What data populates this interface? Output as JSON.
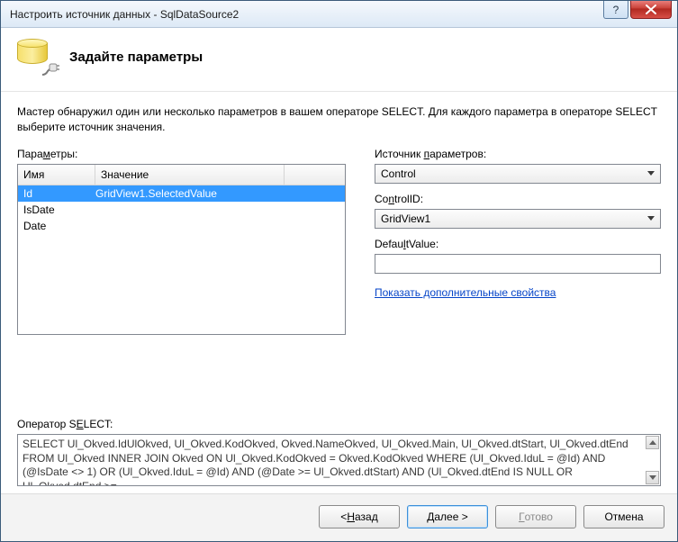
{
  "window_title": "Настроить источник данных - SqlDataSource2",
  "header": {
    "title": "Задайте параметры"
  },
  "instruction": "Мастер обнаружил один или несколько параметров в вашем операторе SELECT. Для каждого параметра в операторе SELECT выберите источник значения.",
  "left": {
    "params_label_pre": "Пара",
    "params_label_u": "м",
    "params_label_post": "етры:",
    "col_name": "Имя",
    "col_value": "Значение",
    "rows": [
      {
        "name": "Id",
        "value": "GridView1.SelectedValue"
      },
      {
        "name": "IsDate",
        "value": ""
      },
      {
        "name": "Date",
        "value": ""
      }
    ]
  },
  "right": {
    "src_label_pre": "Источник ",
    "src_label_u": "п",
    "src_label_post": "араметров:",
    "src_value": "Control",
    "ctrlid_label_pre": "Co",
    "ctrlid_label_u": "n",
    "ctrlid_label_post": "trolID:",
    "ctrlid_value": "GridView1",
    "default_label_pre": "Defau",
    "default_label_u": "l",
    "default_label_post": "tValue:",
    "default_value": "",
    "advanced_link": "Показать дополнительные свойства"
  },
  "sql": {
    "label": "Оператор S",
    "label_u": "E",
    "label_post": "LECT:",
    "text": "SELECT Ul_Okved.IdUlOkved, Ul_Okved.KodOkved, Okved.NameOkved, Ul_Okved.Main, Ul_Okved.dtStart, Ul_Okved.dtEnd FROM Ul_Okved INNER JOIN Okved ON Ul_Okved.KodOkved = Okved.KodOkved WHERE (Ul_Okved.IduL = @Id) AND (@IsDate <> 1) OR (Ul_Okved.IduL = @Id) AND (@Date >= Ul_Okved.dtStart) AND (Ul_Okved.dtEnd IS NULL OR Ul_Okved.dtEnd >="
  },
  "buttons": {
    "back_pre": "< ",
    "back_u": "Н",
    "back_post": "азад",
    "next_pre": "",
    "next_u": "Д",
    "next_post": "алее >",
    "finish_pre": "",
    "finish_u": "Г",
    "finish_post": "отово",
    "cancel": "Отмена"
  }
}
